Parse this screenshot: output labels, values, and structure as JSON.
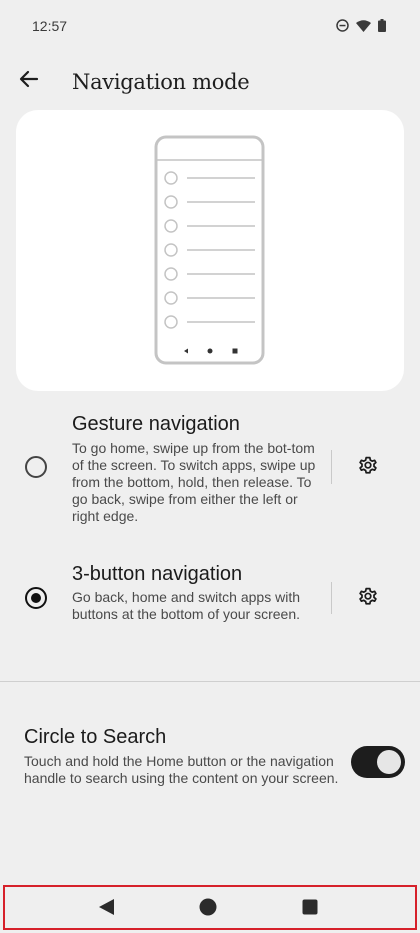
{
  "status_bar": {
    "time": "12:57",
    "icons": [
      "do-not-disturb-icon",
      "wifi-icon",
      "battery-icon"
    ]
  },
  "app_bar": {
    "title": "Navigation mode",
    "back_icon": "arrow-back-icon"
  },
  "illustration": {
    "list_rows": 7
  },
  "options": [
    {
      "title": "Gesture navigation",
      "description": "To go home, swipe up from the bot-tom of the screen. To switch apps, swipe up from the bottom, hold, then release. To go back, swipe from either the left or right edge.",
      "selected": false,
      "settings_icon": "gear-icon"
    },
    {
      "title": "3-button navigation",
      "description": "Go back, home and switch apps with buttons at the bottom of your screen.",
      "selected": true,
      "settings_icon": "gear-icon"
    }
  ],
  "circle_to_search": {
    "title": "Circle to Search",
    "description": "Touch and hold the Home button or the navigation handle to search using the content on your screen.",
    "enabled": true
  },
  "nav_bar": {
    "buttons": [
      "back-triangle-icon",
      "home-circle-icon",
      "recents-square-icon"
    ],
    "highlight_color": "#d6202a"
  },
  "colors": {
    "background": "#efefef",
    "card": "#ffffff",
    "toggle_on": "#1d1d1d"
  }
}
